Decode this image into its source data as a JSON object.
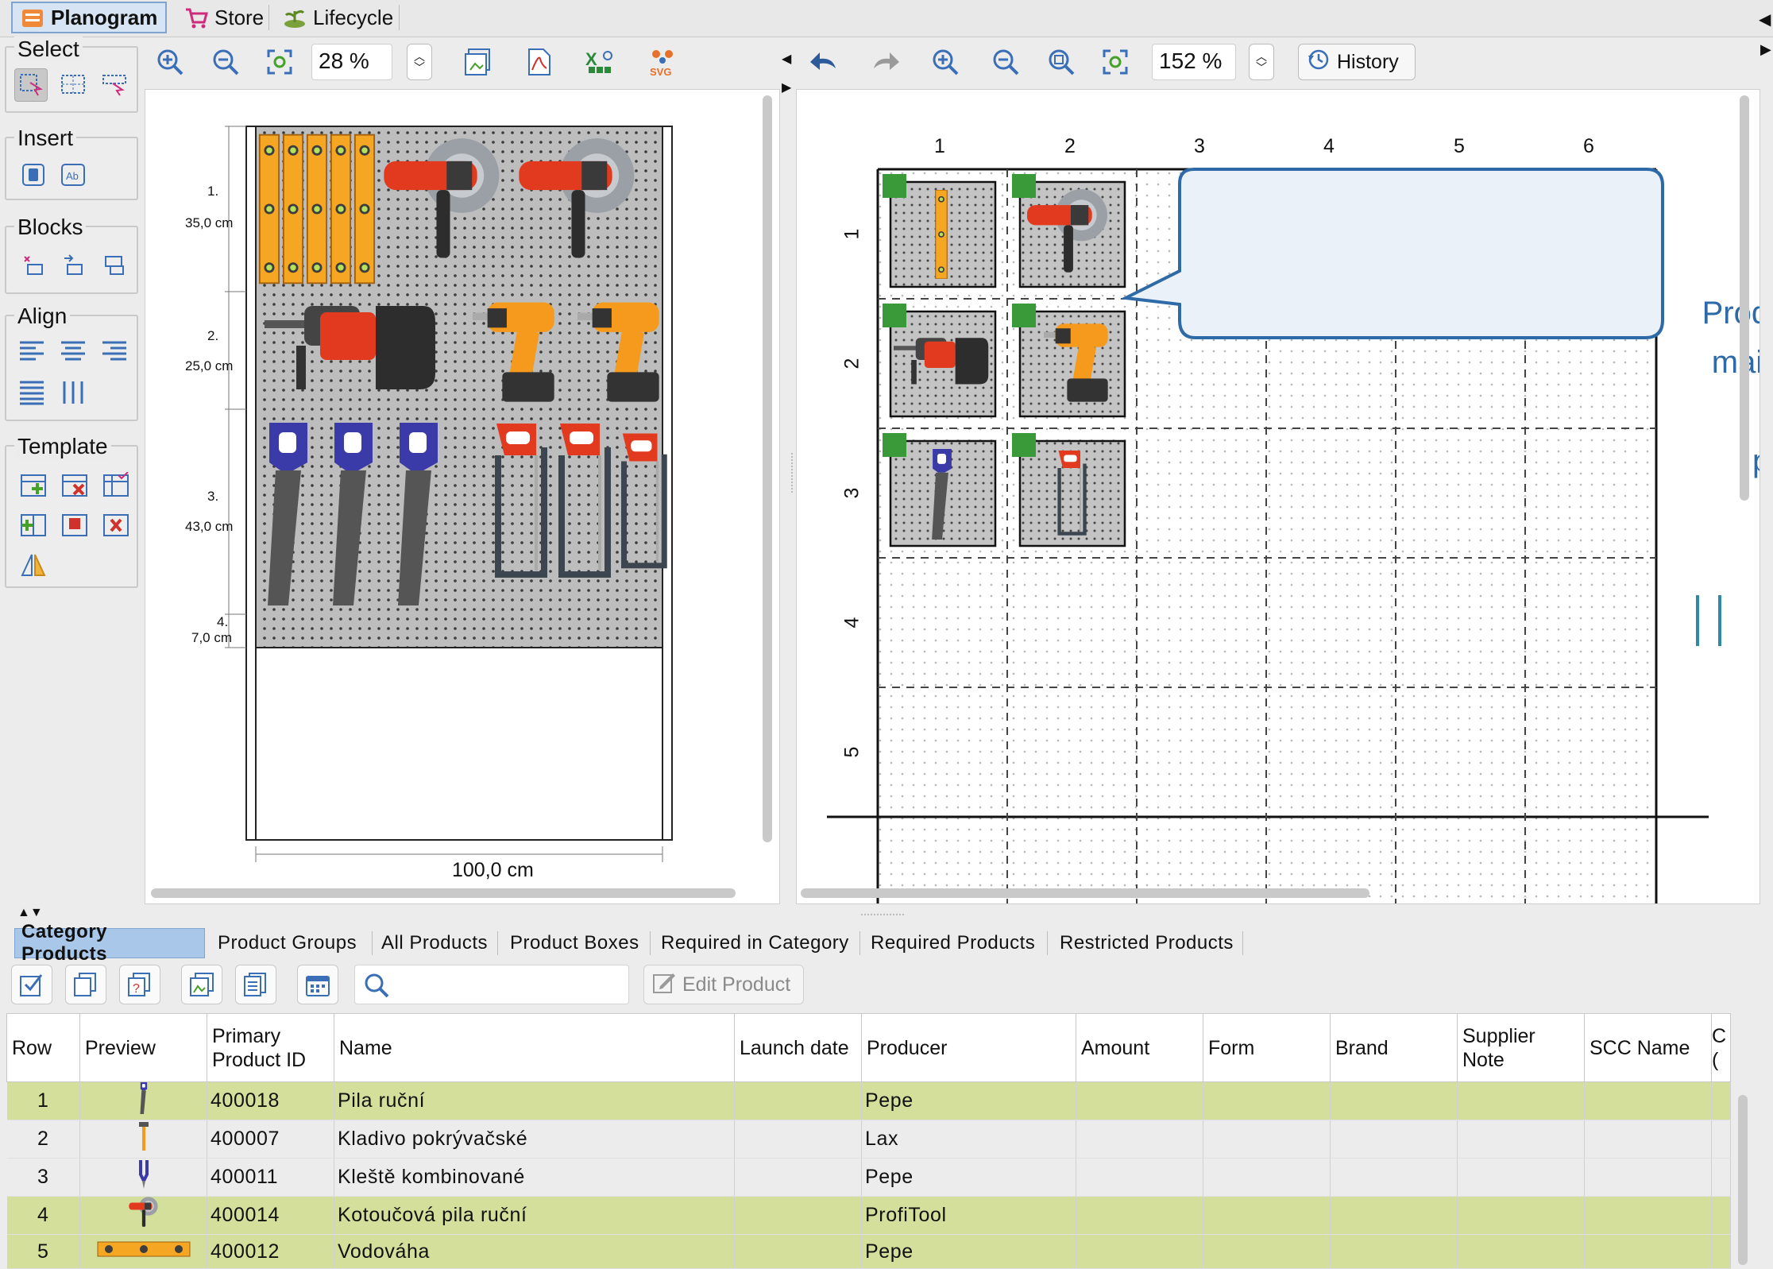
{
  "top_tabs": [
    {
      "label": "Planogram"
    },
    {
      "label": "Store"
    },
    {
      "label": "Lifecycle"
    }
  ],
  "toolbox": {
    "select": "Select",
    "insert": "Insert",
    "blocks": "Blocks",
    "align": "Align",
    "template": "Template"
  },
  "left_toolbar": {
    "zoom": "28 %"
  },
  "right_toolbar": {
    "zoom": "152 %",
    "history_label": "History"
  },
  "planogram": {
    "shelves": [
      {
        "num": "1.",
        "height": "35,0 cm"
      },
      {
        "num": "2.",
        "height": "25,0 cm"
      },
      {
        "num": "3.",
        "height": "43,0 cm"
      },
      {
        "num": "4.",
        "height": "7,0 cm"
      }
    ],
    "width_label": "100,0 cm"
  },
  "grid": {
    "columns": [
      "1",
      "2",
      "3",
      "4",
      "5",
      "6"
    ],
    "rows": [
      "1",
      "2",
      "3",
      "4",
      "5"
    ],
    "callout": "Product images are mainly used in the creation of planograms."
  },
  "product_tabs": [
    {
      "label": "Category Products"
    },
    {
      "label": "Product Groups"
    },
    {
      "label": "All Products"
    },
    {
      "label": "Product Boxes"
    },
    {
      "label": "Required in Category"
    },
    {
      "label": "Required Products"
    },
    {
      "label": "Restricted Products"
    }
  ],
  "product_toolbar": {
    "search_placeholder": "",
    "edit_label": "Edit Product"
  },
  "table": {
    "headers": [
      "Row",
      "Preview",
      "Primary Product ID",
      "Name",
      "Launch date",
      "Producer",
      "Amount",
      "Form",
      "Brand",
      "Supplier Note",
      "SCC Name",
      "C ("
    ],
    "rows": [
      {
        "row": "1",
        "id": "400018",
        "name": "Pila ruční",
        "producer": "Pepe",
        "highlight": true
      },
      {
        "row": "2",
        "id": "400007",
        "name": "Kladivo pokrývačské",
        "producer": "Lax",
        "highlight": false
      },
      {
        "row": "3",
        "id": "400011",
        "name": "Kleště kombinované",
        "producer": "Pepe",
        "highlight": false
      },
      {
        "row": "4",
        "id": "400014",
        "name": "Kotoučová pila ruční",
        "producer": "ProfiTool",
        "highlight": true
      },
      {
        "row": "5",
        "id": "400012",
        "name": "Vodováha",
        "producer": "Pepe",
        "highlight": true
      }
    ]
  }
}
